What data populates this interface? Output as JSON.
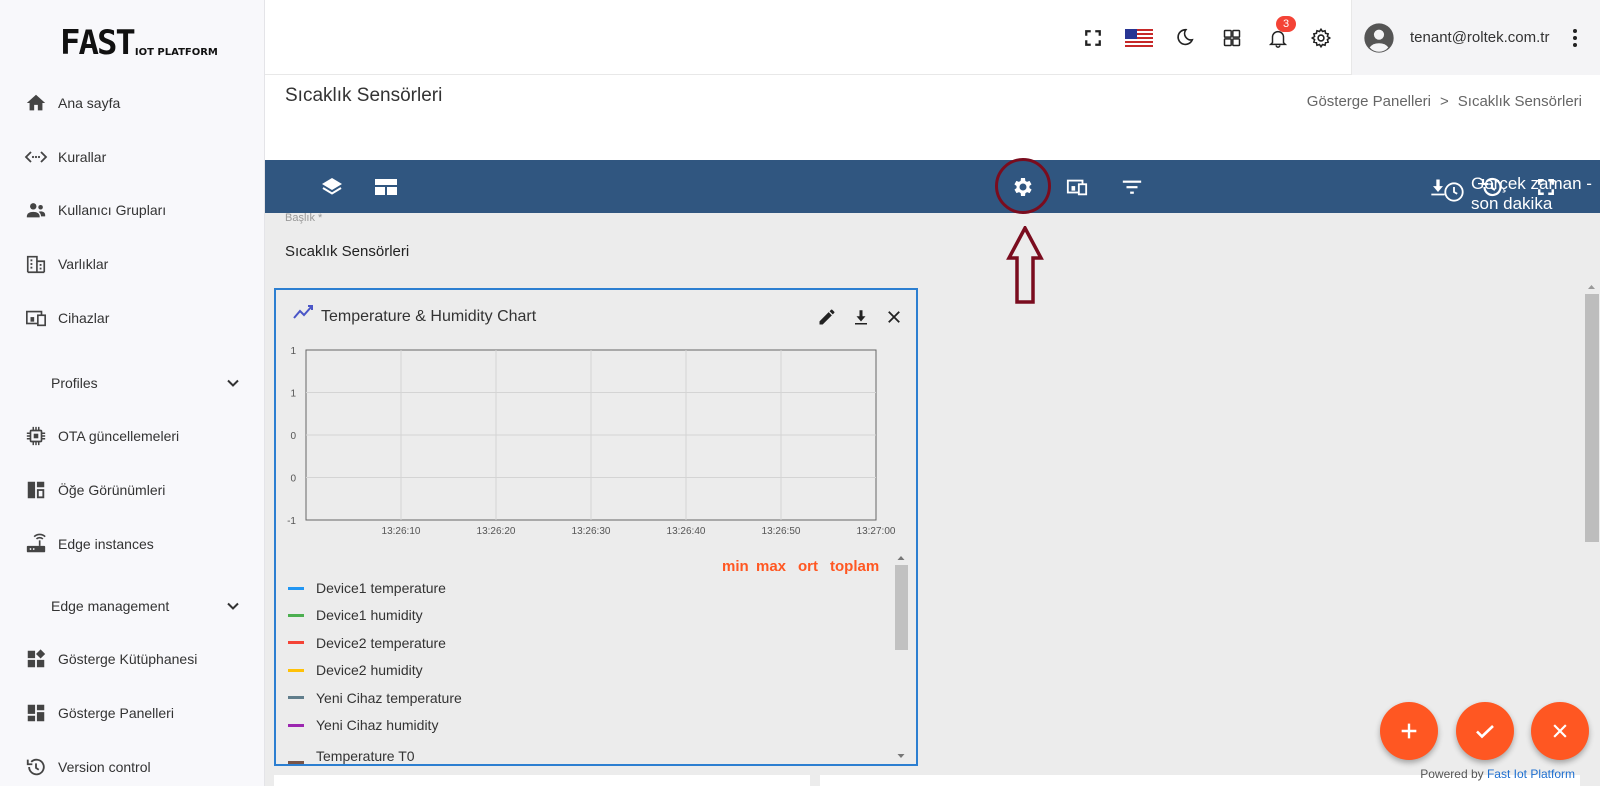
{
  "logo": {
    "big": "FAST",
    "small": "IOT PLATFORM"
  },
  "sidebar": {
    "items": [
      {
        "label": "Ana sayfa",
        "icon": "home-icon"
      },
      {
        "label": "Kurallar",
        "icon": "rule-chain-icon"
      },
      {
        "label": "Kullanıcı Grupları",
        "icon": "people-icon"
      },
      {
        "label": "Varlıklar",
        "icon": "building-icon"
      },
      {
        "label": "Cihazlar",
        "icon": "devices-icon"
      },
      {
        "label": "Profiles",
        "group": true
      },
      {
        "label": "OTA güncellemeleri",
        "icon": "chip-icon"
      },
      {
        "label": "Öğe Görünümleri",
        "icon": "dashboard-layout-icon"
      },
      {
        "label": "Edge instances",
        "icon": "router-icon"
      },
      {
        "label": "Edge management",
        "group": true
      },
      {
        "label": "Gösterge Kütüphanesi",
        "icon": "widgets-icon"
      },
      {
        "label": "Gösterge Panelleri",
        "icon": "dashboard-icon"
      },
      {
        "label": "Version control",
        "icon": "history-icon"
      }
    ]
  },
  "header": {
    "notification_count": "3",
    "user_email": "tenant@roltek.com.tr"
  },
  "page": {
    "title": "Sıcaklık Sensörleri",
    "breadcrumb": [
      "Gösterge Panelleri",
      ">",
      "Sıcaklık Sensörleri"
    ]
  },
  "toolbar": {
    "realtime_label": "Gerçek zaman - son dakika"
  },
  "title_field": {
    "label": "Başlık *",
    "value": "Sıcaklık Sensörleri"
  },
  "widget": {
    "title": "Temperature & Humidity Chart",
    "legend_headers": [
      "min",
      "max",
      "ort",
      "toplam"
    ],
    "legend_partial": "Temperature T0"
  },
  "chart_data": {
    "type": "line",
    "title": "",
    "x": [
      "13:26:10",
      "13:26:20",
      "13:26:30",
      "13:26:40",
      "13:26:50",
      "13:27:00"
    ],
    "y_ticks": [
      "1",
      "1",
      "0",
      "0",
      "-1"
    ],
    "ylim": [
      -1,
      1
    ],
    "grid": true,
    "series": [
      {
        "name": "Device1 temperature",
        "color": "#2196f3",
        "values": []
      },
      {
        "name": "Device1 humidity",
        "color": "#4caf50",
        "values": []
      },
      {
        "name": "Device2 temperature",
        "color": "#f44336",
        "values": []
      },
      {
        "name": "Device2 humidity",
        "color": "#ffc107",
        "values": []
      },
      {
        "name": "Yeni Cihaz temperature",
        "color": "#607d8b",
        "values": []
      },
      {
        "name": "Yeni Cihaz humidity",
        "color": "#9c27b0",
        "values": []
      }
    ]
  },
  "fabs": {
    "add": "+",
    "apply": "✓",
    "cancel": "×"
  },
  "footer": {
    "powered_prefix": "Powered by",
    "powered_brand": "Fast Iot Platform"
  },
  "colors": {
    "toolbar": "#305680",
    "accent": "#ff5722",
    "highlight": "#7a0c1e",
    "widget_border": "#2c7fd1"
  }
}
